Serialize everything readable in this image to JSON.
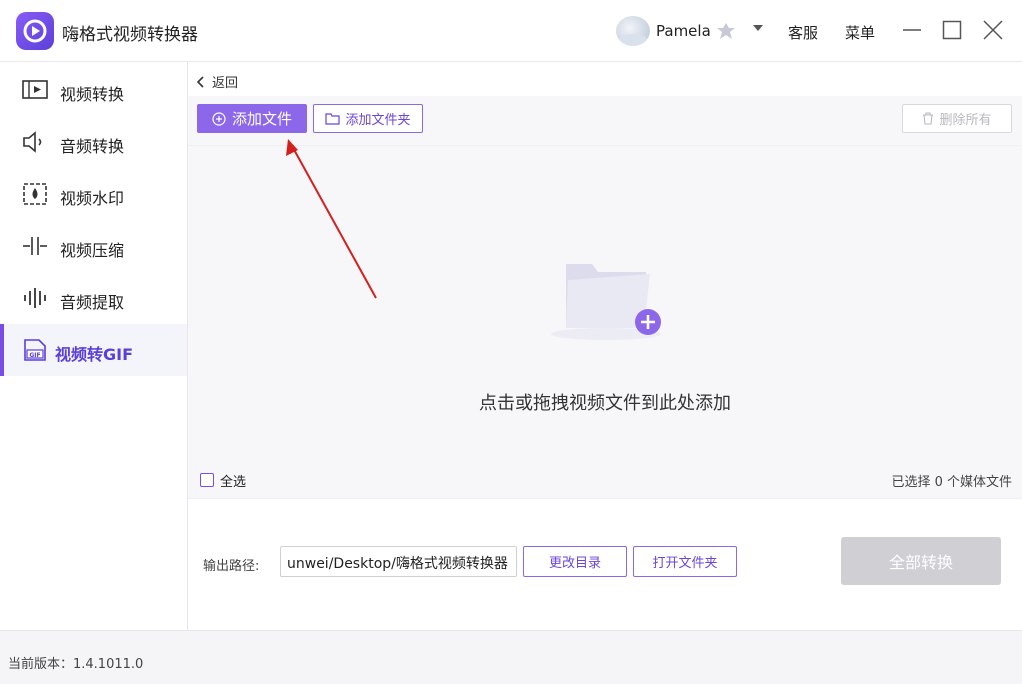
{
  "app": {
    "title": "嗨格式视频转换器"
  },
  "user": {
    "name": "Pamela",
    "dropdown_icon": "caret-down"
  },
  "top_links": {
    "service": "客服",
    "menu": "菜单"
  },
  "sidebar": {
    "items": [
      {
        "label": "视频转换",
        "icon": "video-convert-icon"
      },
      {
        "label": "音频转换",
        "icon": "audio-convert-icon"
      },
      {
        "label": "视频水印",
        "icon": "watermark-icon"
      },
      {
        "label": "视频压缩",
        "icon": "compress-icon"
      },
      {
        "label": "音频提取",
        "icon": "audio-extract-icon"
      },
      {
        "label": "视频转GIF",
        "icon": "gif-icon",
        "active": true
      }
    ]
  },
  "main": {
    "back_label": "返回",
    "toolbar": {
      "add_file": "添加文件",
      "add_folder": "添加文件夹",
      "delete_all": "删除所有"
    },
    "dropzone": {
      "hint": "点击或拖拽视频文件到此处添加"
    },
    "select_all_label": "全选",
    "selected_count": "已选择 0 个媒体文件",
    "output": {
      "label": "输出路径:",
      "path": "unwei/Desktop/嗨格式视频转换器",
      "change_dir": "更改目录",
      "open_folder": "打开文件夹",
      "convert_all": "全部转换"
    }
  },
  "footer": {
    "version": "当前版本：1.4.1011.0"
  },
  "colors": {
    "accent": "#8c67ea",
    "accent_dark": "#5b3fd9",
    "disabled": "#cfcfd4",
    "arrow": "#d41f1f"
  }
}
